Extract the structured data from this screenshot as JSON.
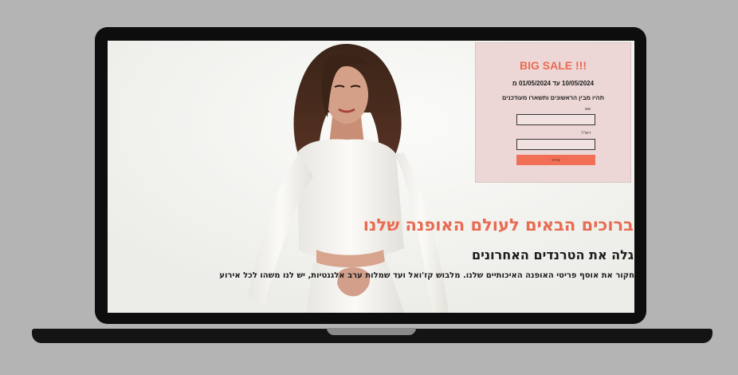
{
  "sale": {
    "title": "!!! BIG SALE",
    "dates": "10/05/2024 עד 01/05/2024 מ",
    "tagline": "תהיו מבין הראשונים ותשארו מעודכנים",
    "name_label": "שם",
    "email_label": "דוא\"ל",
    "submit_label": "שליחה"
  },
  "hero": {
    "title": "ברוכים הבאים לעולם האופנה שלנו",
    "subtitle": "גלה את הטרנדים האחרונים",
    "description": "חקור את אוסף פריטי האופנה האיכותיים שלנו. מלבוש קז'ואל ועד שמלות ערב אלגנטיות, יש לנו משהו לכל אירוע"
  },
  "colors": {
    "accent": "#e86b51",
    "card_bg": "#ecd7d6",
    "page_bg": "#b3b4b3"
  }
}
